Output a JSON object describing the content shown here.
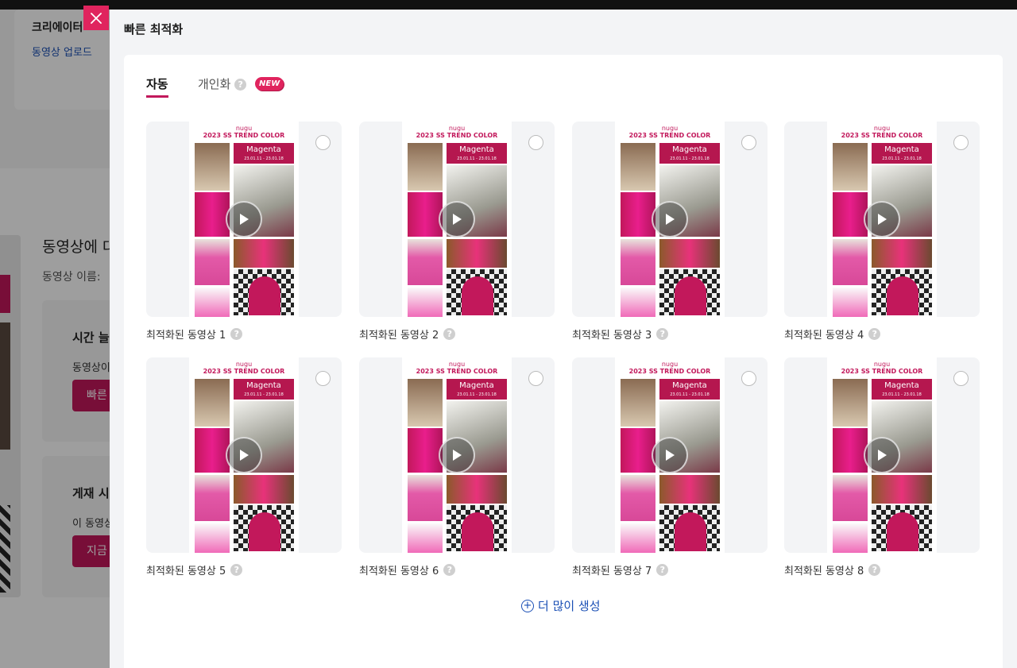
{
  "background": {
    "title": "크리에이터",
    "link": "동영상 업로드",
    "section_heading": "동영상에 대",
    "section_sub": "동영상 이름:",
    "box1_title": "시간 늘",
    "box1_desc": "동영상이",
    "box1_button": "빠른",
    "box2_title": "게재 시",
    "box2_desc": "이 동영상",
    "box2_button": "지금"
  },
  "panel": {
    "title": "빠른 최적화",
    "tabs": [
      {
        "label": "자동",
        "active": true
      },
      {
        "label": "개인화",
        "badge": "NEW"
      }
    ],
    "help_glyph": "?",
    "videos": [
      {
        "label": "최적화된 동영상 1"
      },
      {
        "label": "최적화된 동영상 2"
      },
      {
        "label": "최적화된 동영상 3"
      },
      {
        "label": "최적화된 동영상 4"
      },
      {
        "label": "최적화된 동영상 5"
      },
      {
        "label": "최적화된 동영상 6"
      },
      {
        "label": "최적화된 동영상 7"
      },
      {
        "label": "최적화된 동영상 8"
      }
    ],
    "poster": {
      "brand": "nugu",
      "headline": "2023 SS TREND COLOR",
      "color_name": "Magenta",
      "date_range": "23.01.11 - 23.01.18"
    },
    "more_button": "더 많이 생성"
  },
  "colors": {
    "accent": "#e0245e",
    "magenta": "#b5174f",
    "link": "#1a4fb5"
  },
  "icons": {
    "close": "close-icon",
    "play": "play-icon",
    "help": "help-icon",
    "add": "plus-circle-icon"
  }
}
